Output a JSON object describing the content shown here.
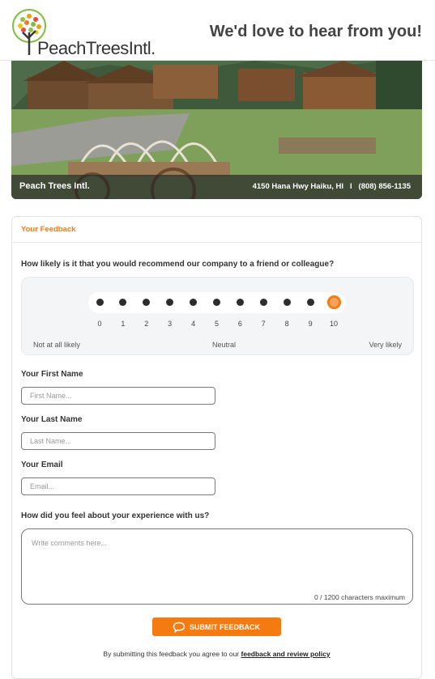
{
  "header": {
    "logo_text": "PeachTreesIntl.",
    "tagline": "We'd love to hear from you!"
  },
  "hero": {
    "business_name": "Peach Trees Intl.",
    "address": "4150 Hana Hwy Haiku, HI",
    "separator": "I",
    "phone": "(808) 856-1135"
  },
  "feedback": {
    "section_title": "Your Feedback",
    "nps": {
      "question": "How likely is it that you would recommend our company to a friend or colleague?",
      "scale": [
        "0",
        "1",
        "2",
        "3",
        "4",
        "5",
        "6",
        "7",
        "8",
        "9",
        "10"
      ],
      "selected": "10",
      "low_label": "Not at all likely",
      "mid_label": "Neutral",
      "high_label": "Very likely"
    },
    "first_name": {
      "label": "Your First Name",
      "placeholder": "First Name...",
      "value": ""
    },
    "last_name": {
      "label": "Your Last Name",
      "placeholder": "Last Name...",
      "value": ""
    },
    "email": {
      "label": "Your Email",
      "placeholder": "Email...",
      "value": ""
    },
    "experience": {
      "question": "How did you feel about your experience with us?",
      "placeholder": "Write comments here...",
      "counter": "0 / 1200 characters maximum"
    },
    "submit_label": "SUBMIT FEEDBACK",
    "policy_text": "By submitting this feedback you agree to our",
    "policy_link": "feedback and review policy"
  },
  "colors": {
    "accent": "#f57a12",
    "accent_text": "#f07a1c",
    "hero_bar": "#282828"
  },
  "icons": {
    "logo": "peach-tree-icon",
    "submit": "speech-bubble-icon"
  }
}
